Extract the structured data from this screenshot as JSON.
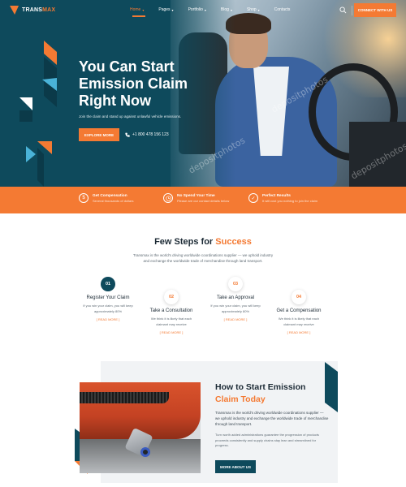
{
  "brand": {
    "name_left": "TRANS",
    "name_right": "MAX"
  },
  "nav": {
    "items": [
      {
        "label": "Home",
        "caret": true
      },
      {
        "label": "Pages",
        "caret": true
      },
      {
        "label": "Portfolio",
        "caret": true
      },
      {
        "label": "Blog",
        "caret": true
      },
      {
        "label": "Shop",
        "caret": true
      },
      {
        "label": "Contacts",
        "caret": false
      }
    ],
    "contact_button": "CONNECT WITH US"
  },
  "hero": {
    "title_line1": "You Can Start",
    "title_line2": "Emission Claim",
    "title_line3": "Right Now",
    "subtitle": "Join the claim and stand up against unlawful vehicle emissions.",
    "cta": "EXPLORE MORE",
    "phone": "+1 800 478 156 123",
    "watermarks": [
      "depositphotos",
      "depositphotos",
      "depositphotos"
    ]
  },
  "features": [
    {
      "icon": "dollar-icon",
      "title": "Get Compensation",
      "desc": "Several thousands of dollars"
    },
    {
      "icon": "clock-icon",
      "title": "No Spend Your Time",
      "desc": "Please are our contact details below"
    },
    {
      "icon": "check-icon",
      "title": "Perfect Results",
      "desc": "It will cost you nothing to join the claim"
    }
  ],
  "steps_section": {
    "title_main": "Few Steps for ",
    "title_accent": "Success",
    "desc_line1": "Transmax is the world's driving worldwide coordinations supplier — we uphold industry",
    "desc_line2": "and exchange the worldwide trade of merchandise through land transport."
  },
  "steps": [
    {
      "num": "01",
      "title": "Register Your Claim",
      "desc1": "If you win your claim, you will keep",
      "desc2": "approximately 80%",
      "link": "[ READ MORE ]"
    },
    {
      "num": "02",
      "title": "Take a Consultation",
      "desc1": "We think it is likely that each",
      "desc2": "claimant may receive",
      "link": "[ READ MORE ]"
    },
    {
      "num": "03",
      "title": "Take an Approval",
      "desc1": "If you win your claim, you will keep",
      "desc2": "approximately 80%",
      "link": "[ READ MORE ]"
    },
    {
      "num": "04",
      "title": "Get a Compensation",
      "desc1": "We think it is likely that each",
      "desc2": "claimant may receive",
      "link": "[ READ MORE ]"
    }
  ],
  "claim": {
    "title_line1": "How  to Start Emission",
    "title_line2_main": "Claim ",
    "title_line2_accent": "Today",
    "p1": "Transmax is the world's driving worldwide coordinations supplier — we uphold industry and exchange the worldwide trade of merchandise through land transport.",
    "p2": "Turn worth added administrations guarantee the progression of products proceeds consistently and supply chains stay lean and streamlined for progress.",
    "button": "MORE ABOUT US"
  },
  "colors": {
    "teal": "#0e4a5c",
    "orange": "#f47a33",
    "light_blue": "#4ab3d8",
    "bg_gray": "#f1f3f5"
  }
}
